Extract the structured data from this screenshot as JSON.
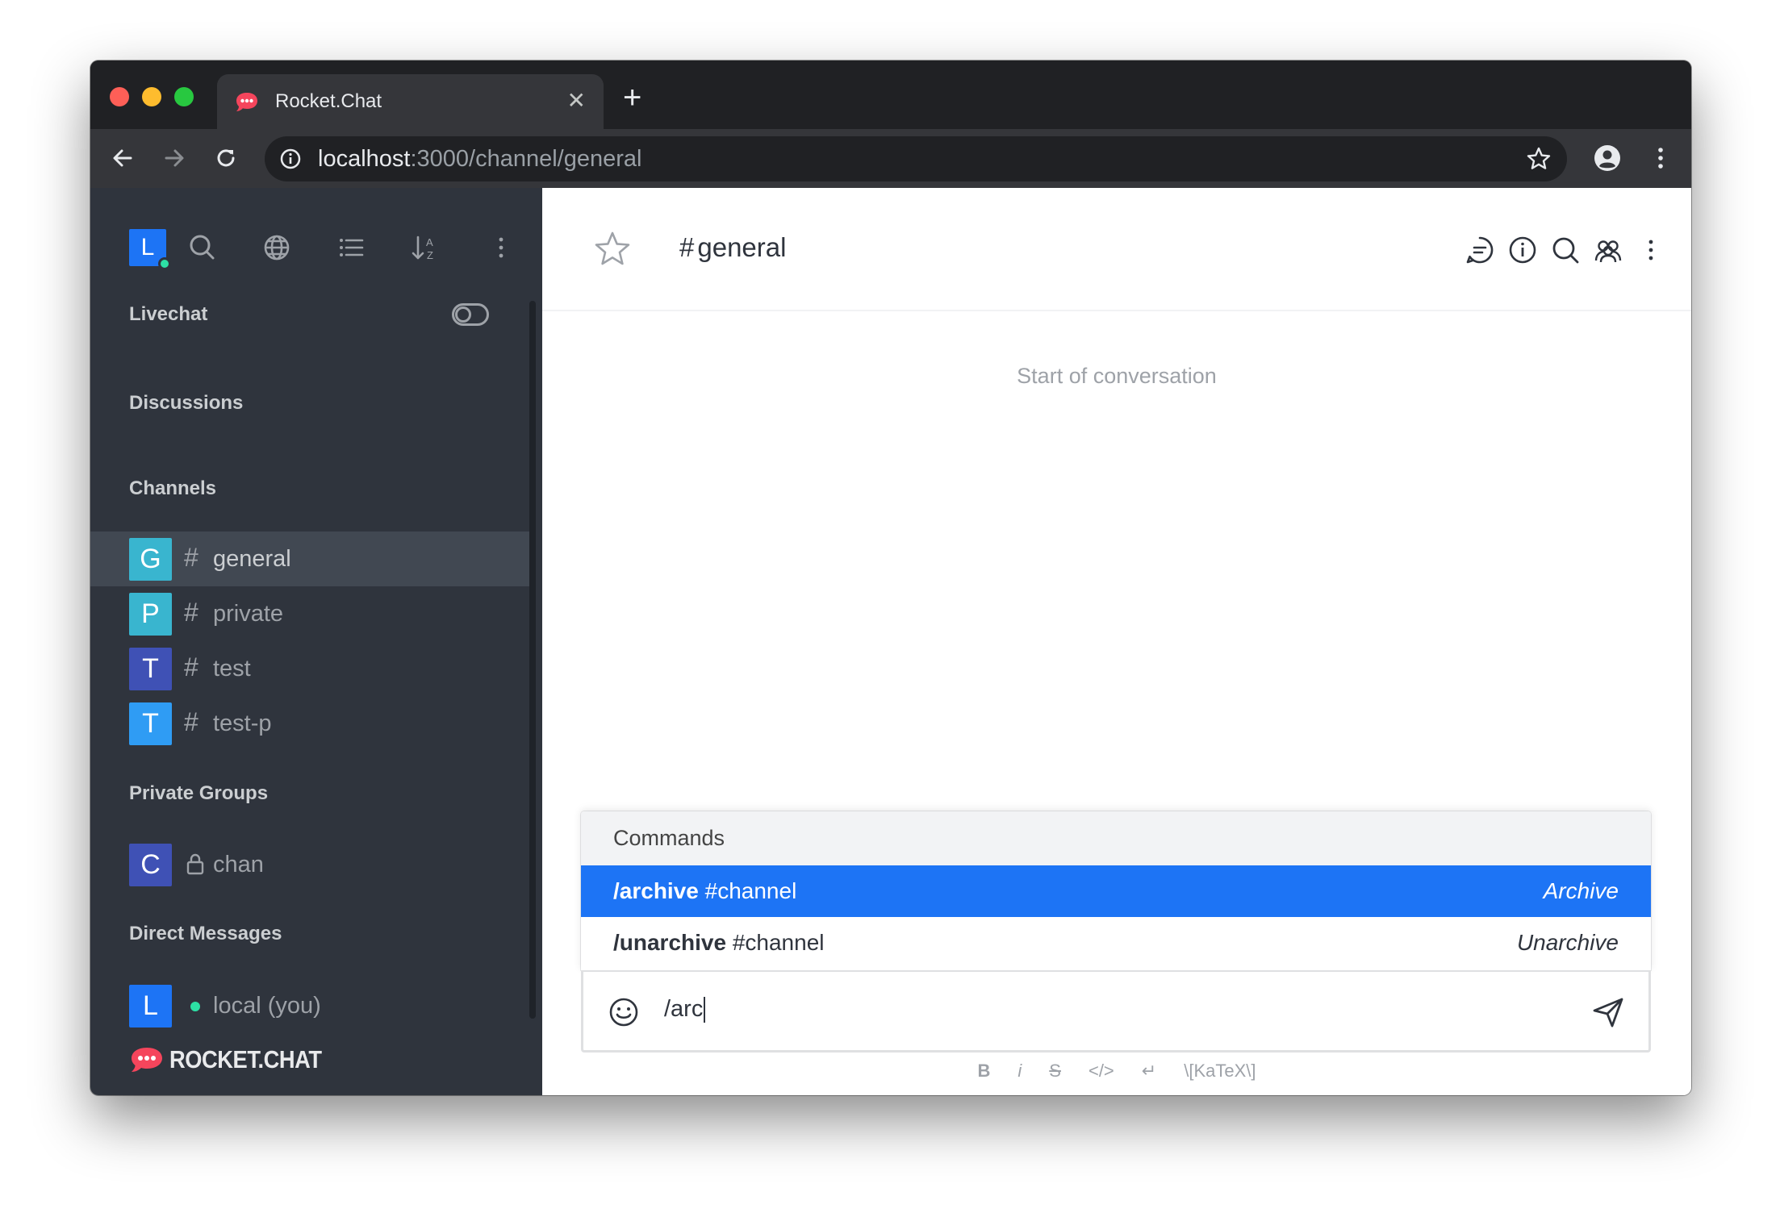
{
  "browser": {
    "tab_title": "Rocket.Chat",
    "tab_close": "✕",
    "new_tab": "+",
    "url_host": "localhost",
    "url_path": ":3000/channel/general"
  },
  "sidebar": {
    "user_initial": "L",
    "sections": {
      "livechat": "Livechat",
      "discussions": "Discussions",
      "channels": "Channels",
      "private_groups": "Private Groups",
      "direct_messages": "Direct Messages"
    },
    "channels": [
      {
        "initial": "G",
        "name": "general",
        "color": "#39b5cf",
        "active": true
      },
      {
        "initial": "P",
        "name": "private",
        "color": "#39b5cf",
        "active": false
      },
      {
        "initial": "T",
        "name": "test",
        "color": "#3f51b5",
        "active": false
      },
      {
        "initial": "T",
        "name": "test-p",
        "color": "#2f9cf4",
        "active": false
      }
    ],
    "private_groups": [
      {
        "initial": "C",
        "name": "chan",
        "color": "#3f51b5"
      }
    ],
    "direct_messages": [
      {
        "initial": "L",
        "name": "local (you)",
        "color": "#1d74f5"
      }
    ],
    "logo_text": "ROCKET.CHAT",
    "accent_color": "#2de0a5"
  },
  "main": {
    "channel_name": "general",
    "start_of_conversation": "Start of conversation",
    "popup": {
      "title": "Commands",
      "items": [
        {
          "command": "/archive",
          "params": " #channel",
          "description": "Archive",
          "selected": true
        },
        {
          "command": "/unarchive",
          "params": " #channel",
          "description": "Unarchive",
          "selected": false
        }
      ]
    },
    "composer": {
      "value": "/arc"
    },
    "format_toolbar": {
      "bold": "B",
      "italic": "i",
      "strike": "S",
      "code": "</>",
      "multiline": "↵",
      "katex": "\\[KaTeX\\]"
    }
  }
}
